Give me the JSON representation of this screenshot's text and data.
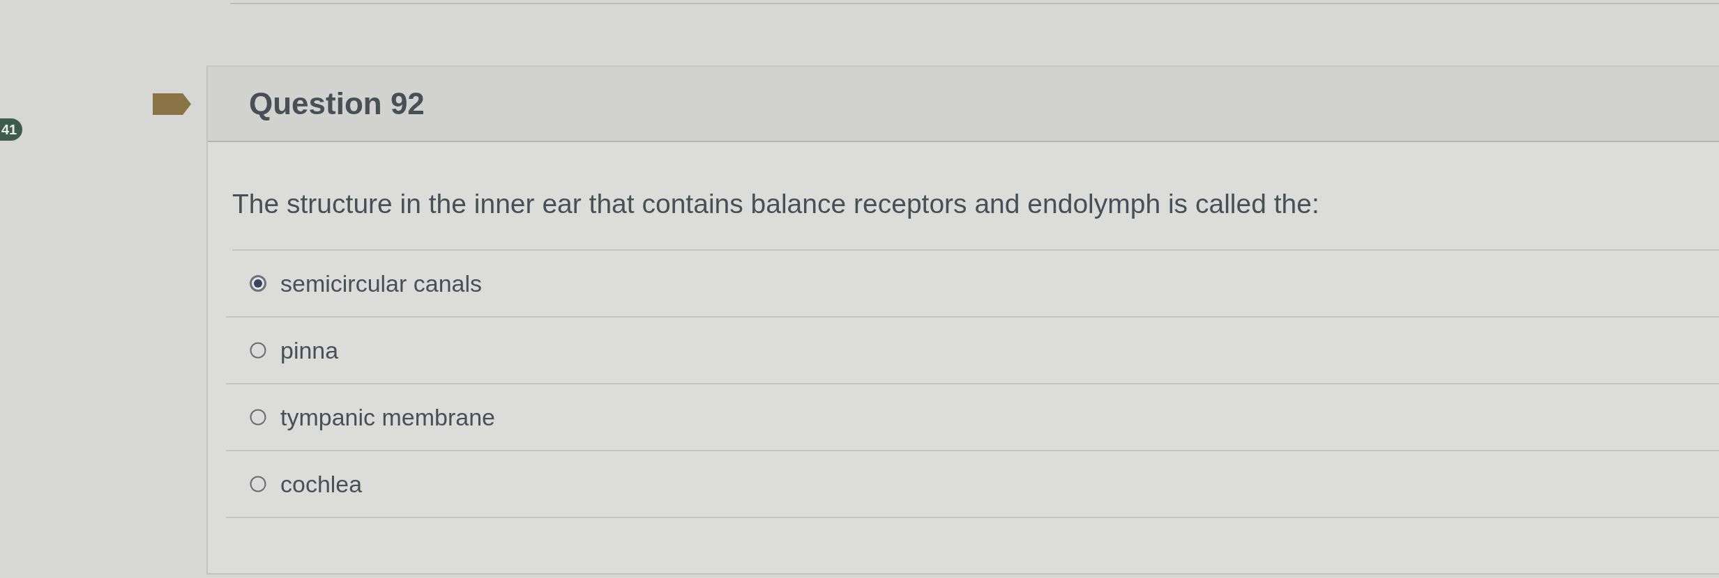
{
  "sidebar": {
    "badge": "41"
  },
  "question": {
    "title": "Question 92",
    "text": "The structure in the inner ear that contains balance receptors and endolymph is called the:",
    "options": [
      {
        "label": "semicircular canals",
        "selected": true
      },
      {
        "label": "pinna",
        "selected": false
      },
      {
        "label": "tympanic membrane",
        "selected": false
      },
      {
        "label": "cochlea",
        "selected": false
      }
    ]
  }
}
